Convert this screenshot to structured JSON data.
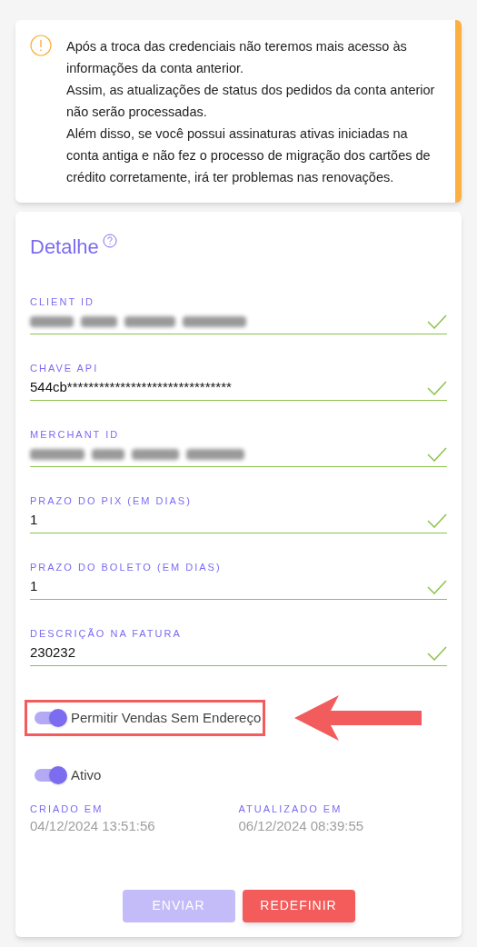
{
  "alert": {
    "text_lines": [
      "Após a troca das credenciais não teremos mais acesso às informações da conta anterior.",
      "Assim, as atualizações de status dos pedidos da conta anterior não serão processadas.",
      "Além disso, se você possui assinaturas ativas iniciadas na conta antiga e não fez o processo de migração dos cartões de crédito corretamente, irá ter problemas nas renovações."
    ]
  },
  "detail": {
    "title": "Detalhe",
    "fields": [
      {
        "label": "CLIENT ID",
        "redacted": true,
        "valid": true
      },
      {
        "label": "CHAVE API",
        "value": "544cb*******************************",
        "valid": true
      },
      {
        "label": "MERCHANT ID",
        "redacted": true,
        "valid": true
      },
      {
        "label": "PRAZO DO PIX (EM DIAS)",
        "value": "1",
        "valid": true
      },
      {
        "label": "PRAZO DO BOLETO (EM DIAS)",
        "value": "1",
        "valid": true
      },
      {
        "label": "DESCRIÇÃO NA FATURA",
        "value": "230232",
        "valid": true
      }
    ],
    "toggles": [
      {
        "label": "Permitir Vendas Sem Endereço",
        "on": true,
        "highlighted": true
      },
      {
        "label": "Ativo",
        "on": true,
        "highlighted": false
      }
    ],
    "dates": [
      {
        "label": "CRIADO EM",
        "value": "04/12/2024 13:51:56"
      },
      {
        "label": "ATUALIZADO EM",
        "value": "06/12/2024 08:39:55"
      }
    ],
    "buttons": [
      {
        "label": "ENVIAR",
        "kind": "primary",
        "disabled": true
      },
      {
        "label": "REDEFINIR",
        "kind": "danger",
        "disabled": false
      }
    ]
  }
}
